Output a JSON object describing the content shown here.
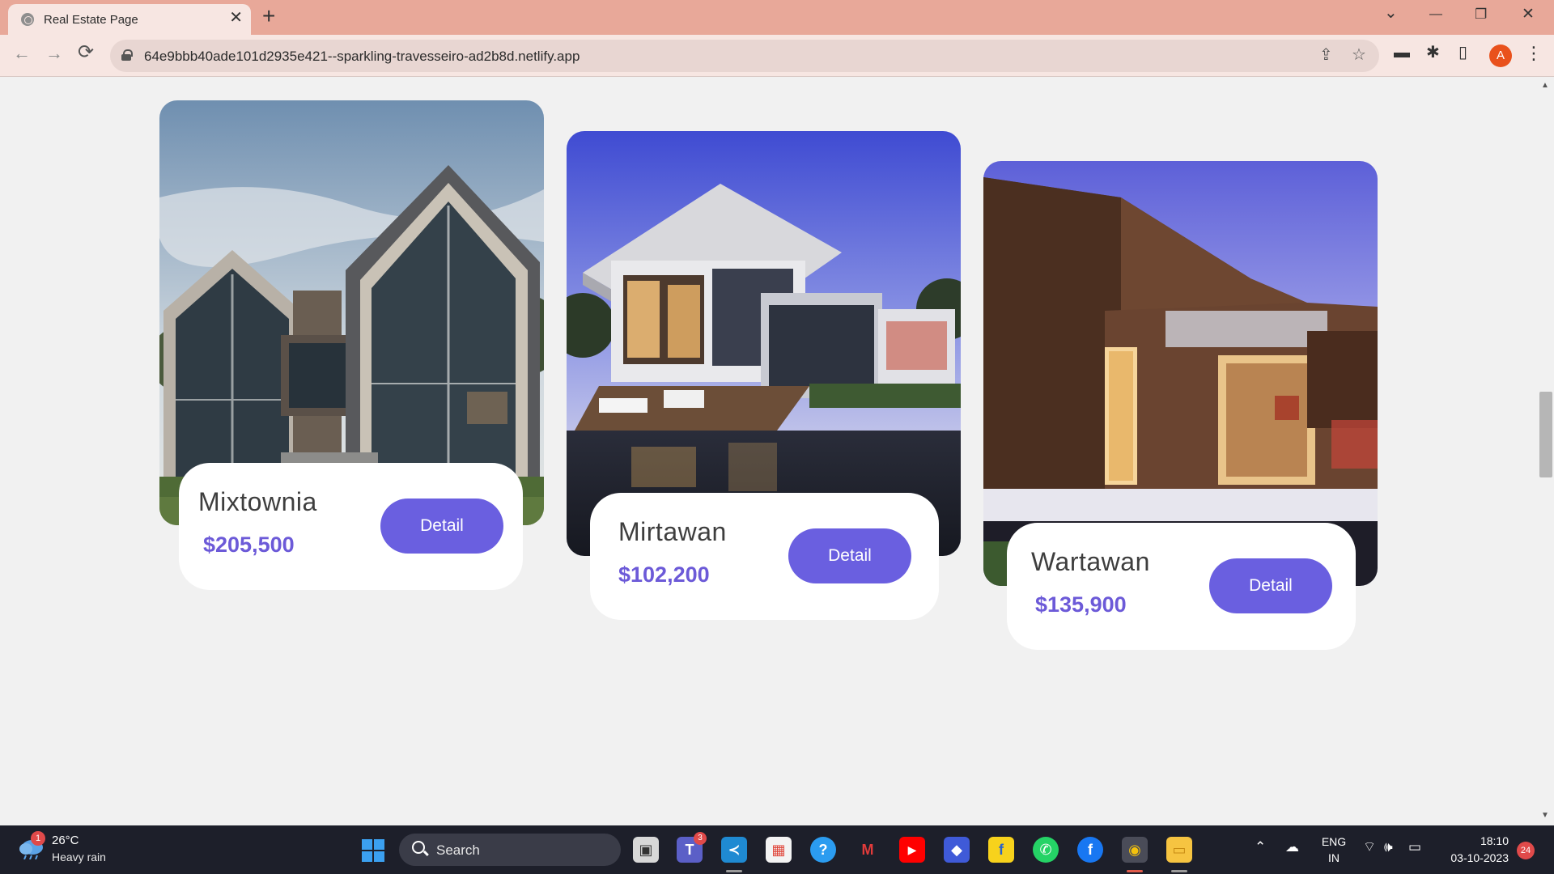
{
  "browser": {
    "tab_title": "Real Estate Page",
    "tab_close": "✕",
    "new_tab": "+",
    "controls": {
      "dropdown": "⌄",
      "minimize": "—",
      "restore": "❐",
      "close": "✕"
    },
    "nav": {
      "back": "←",
      "forward": "→",
      "reload": "⟳"
    },
    "url": "64e9bbb40ade101d2935e421--sparkling-travesseiro-ad2b8d.netlify.app",
    "omnibox_icons": {
      "share": "⇪",
      "bookmark": "☆"
    },
    "toolbar_icons": {
      "cast": "▬",
      "extensions": "✱",
      "sidepanel": "▯",
      "menu": "⋮"
    },
    "profile_initial": "A",
    "accent": "#e9511c"
  },
  "listings": [
    {
      "name": "Mixtownia",
      "price": "$205,500",
      "button": "Detail",
      "image": "gabled-house-photo"
    },
    {
      "name": "Mirtawan",
      "price": "$102,200",
      "button": "Detail",
      "image": "modern-pool-villa-photo"
    },
    {
      "name": "Wartawan",
      "price": "$135,900",
      "button": "Detail",
      "image": "wooden-modern-house-photo"
    }
  ],
  "colors": {
    "accent": "#6a5fe0",
    "price": "#6c5ad8",
    "page_bg": "#f1f1f1",
    "card_bg": "#ffffff"
  },
  "taskbar": {
    "weather": {
      "badge": "1",
      "temp": "26°C",
      "desc": "Heavy rain"
    },
    "search_label": "Search",
    "apps": [
      {
        "name": "task-view-icon",
        "glyph": "▣"
      },
      {
        "name": "teams-icon",
        "glyph": "T",
        "badge": "3"
      },
      {
        "name": "vscode-icon",
        "glyph": "≺"
      },
      {
        "name": "microsoft-store-icon",
        "glyph": "▦"
      },
      {
        "name": "help-icon",
        "glyph": "?"
      },
      {
        "name": "mcafee-icon",
        "glyph": "M"
      },
      {
        "name": "youtube-icon",
        "glyph": "▶"
      },
      {
        "name": "copilot-icon",
        "glyph": "◆"
      },
      {
        "name": "flipkart-icon",
        "glyph": "f"
      },
      {
        "name": "whatsapp-icon",
        "glyph": "✆"
      },
      {
        "name": "facebook-icon",
        "glyph": "f"
      },
      {
        "name": "chrome-icon",
        "glyph": "◉"
      },
      {
        "name": "file-explorer-icon",
        "glyph": "▭"
      }
    ],
    "tray": {
      "chevron": "⌃",
      "onedrive": "☁",
      "lang_top": "ENG",
      "lang_bottom": "IN",
      "wifi": "⌔",
      "volume": "🕪",
      "battery": "▭",
      "time": "18:10",
      "date": "03-10-2023",
      "notifications": "24"
    }
  }
}
